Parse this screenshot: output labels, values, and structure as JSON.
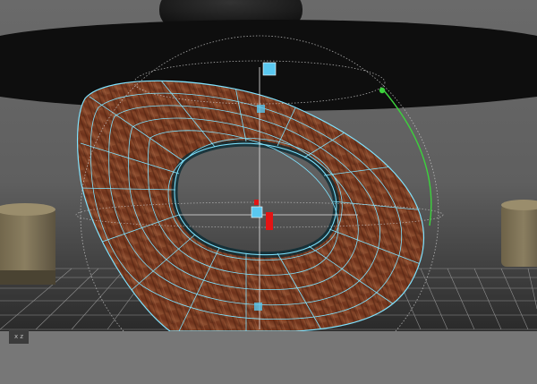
{
  "viewport": {
    "name": "3D viewport",
    "axis_indicator": "x z"
  },
  "colors": {
    "background": "#6d6d6d",
    "wireframe": "#7fe3ff",
    "wood": "#7b3a22",
    "manip_handle": "#5ac8f0",
    "manip_axis_green": "#3cd23c",
    "pivot_red": "#e31414"
  },
  "objects": [
    "overhead-disc",
    "wood-ring-mesh",
    "left-post",
    "right-post",
    "ground-grid",
    "rotate-manipulator"
  ]
}
